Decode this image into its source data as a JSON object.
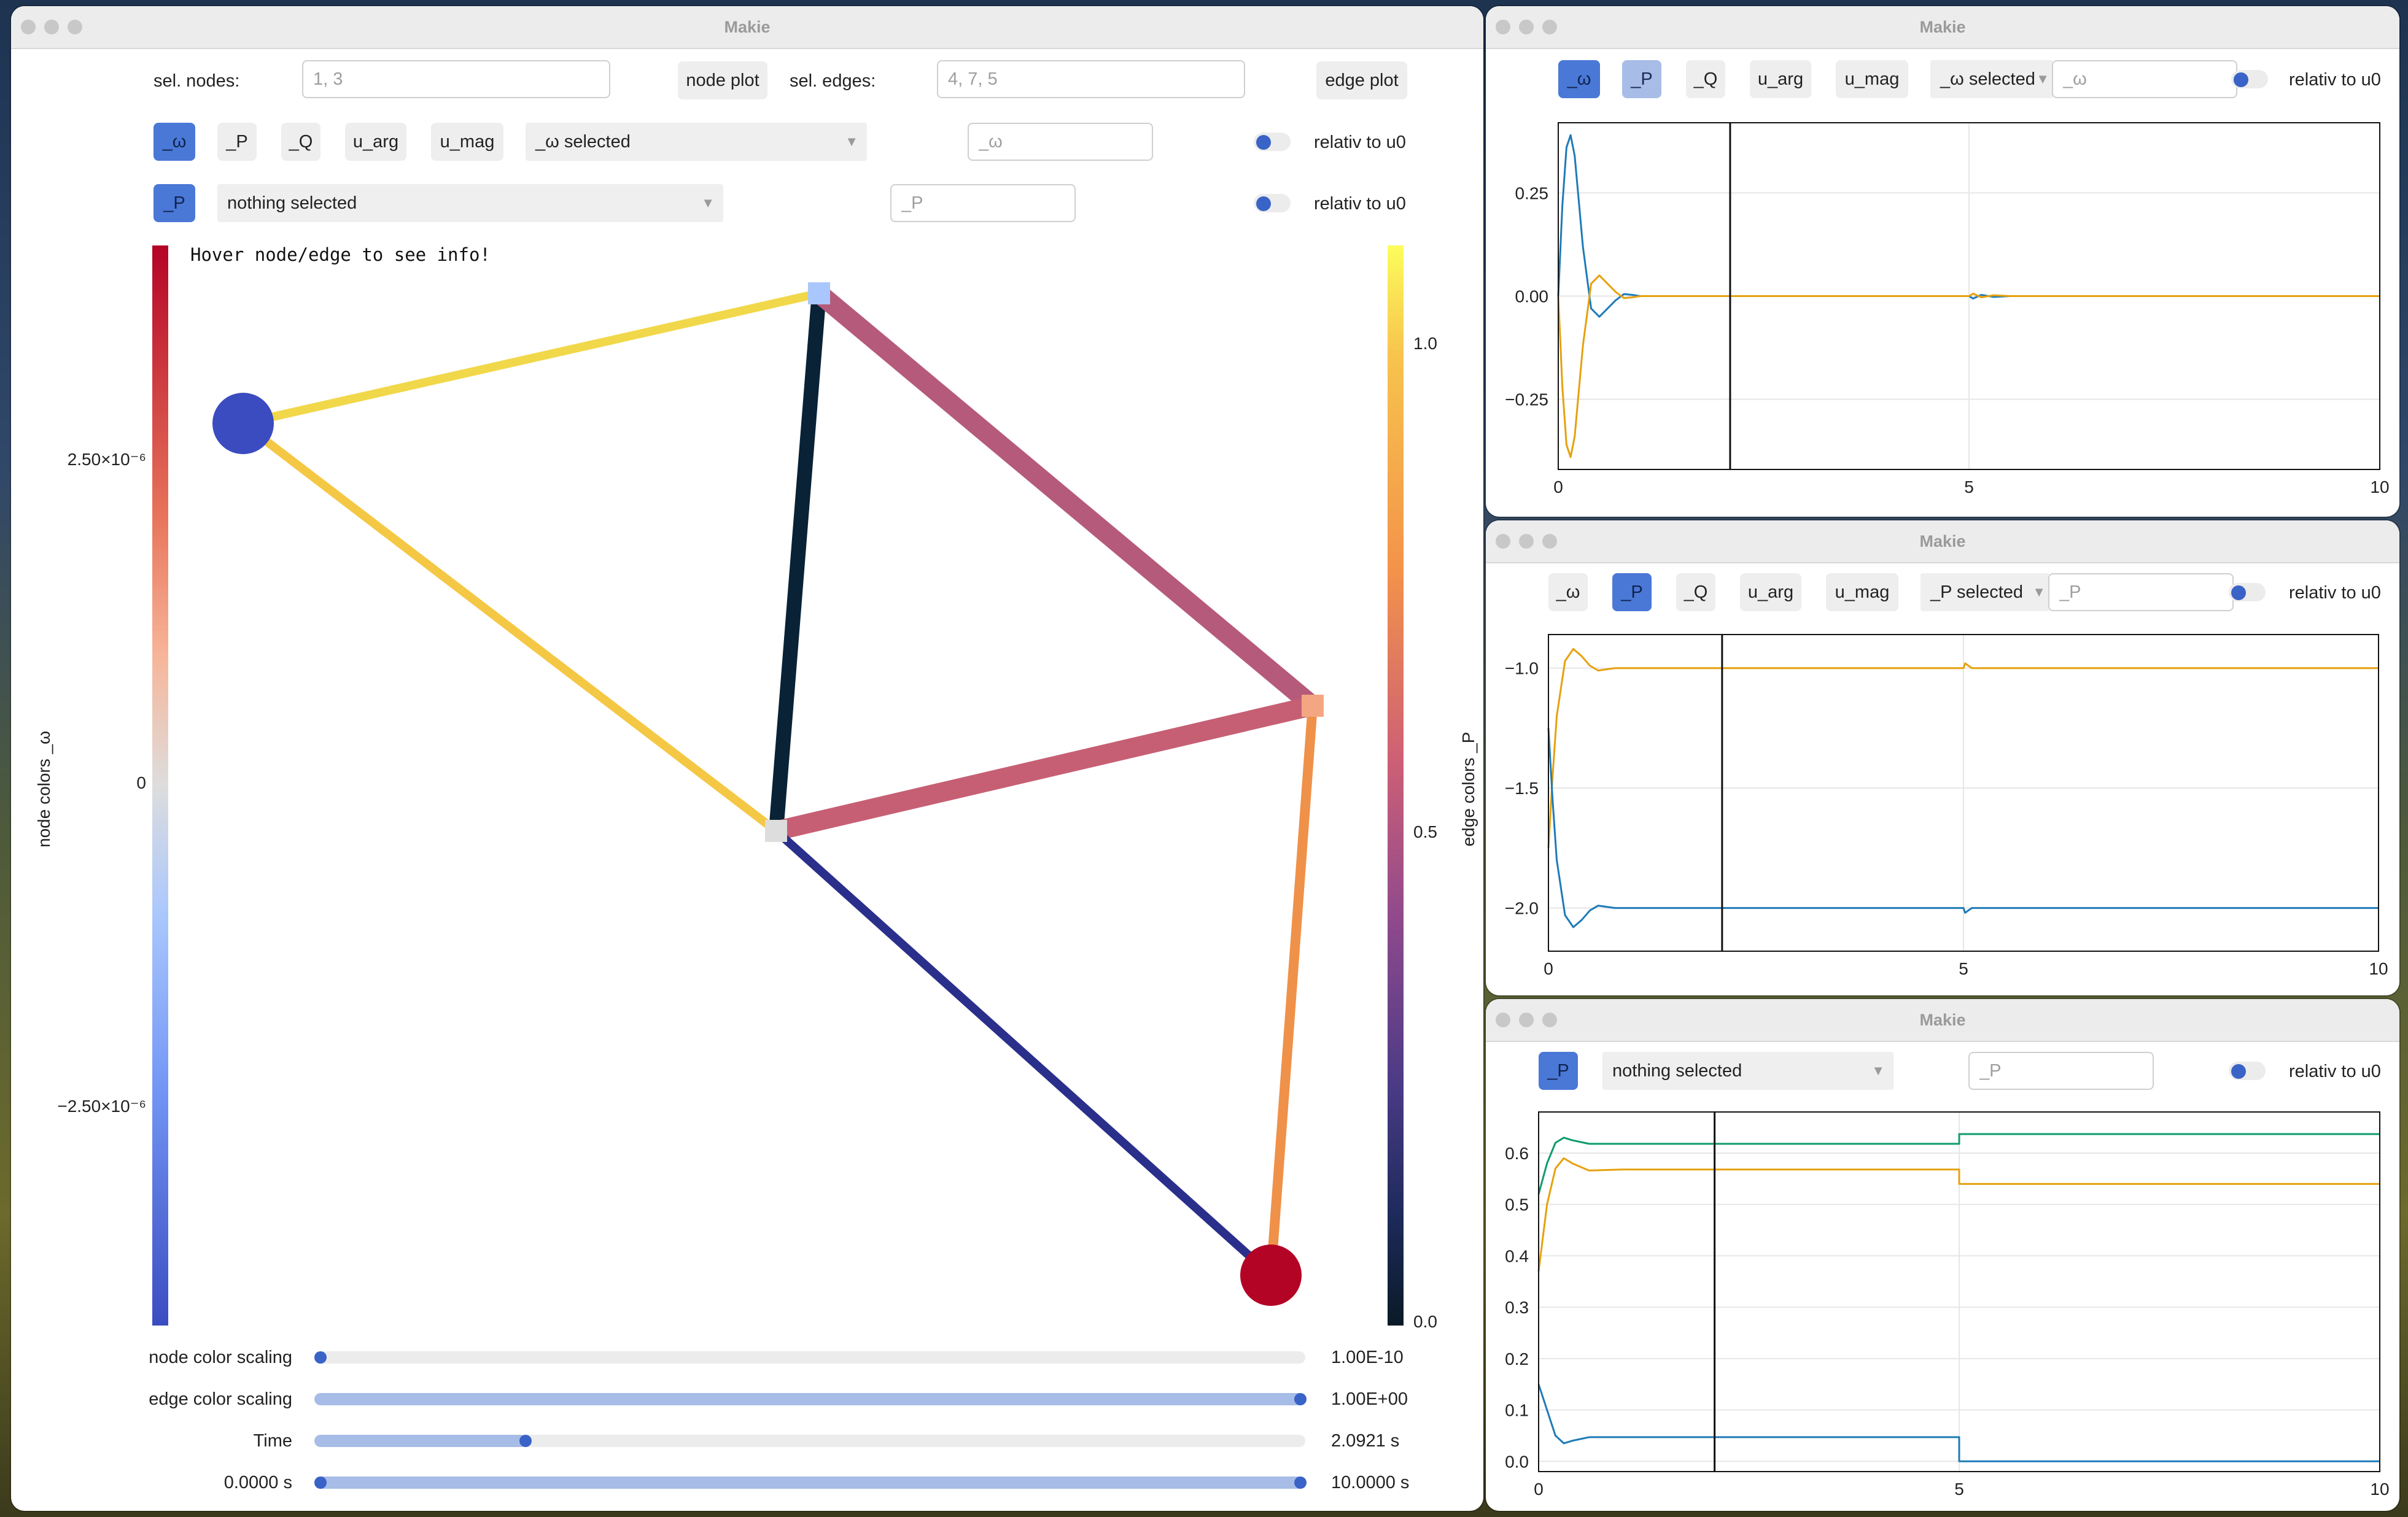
{
  "colors": {
    "accent": "#4a78d6",
    "accent_light": "#a8bce8",
    "edge_high": "#f0d84a",
    "edge_mid": "#c05a78",
    "edge_low": "#0a2236",
    "series_blue": "#1f7bb8",
    "series_orange": "#e6a10e",
    "series_green": "#0e9c6a"
  },
  "main_window": {
    "title": "Makie",
    "sel_nodes_label": "sel. nodes:",
    "sel_nodes_placeholder": "1, 3",
    "node_plot_button": "node plot",
    "sel_edges_label": "sel. edges:",
    "sel_edges_placeholder": "4, 7, 5",
    "edge_plot_button": "edge plot",
    "node_state_buttons": [
      "_ω",
      "_P",
      "_Q",
      "u_arg",
      "u_mag"
    ],
    "node_state_menu": "_ω selected",
    "node_state_textbox_placeholder": "_ω",
    "node_relativ_label": "relativ to u0",
    "edge_state_button": "_P",
    "edge_state_menu": "nothing selected",
    "edge_state_textbox_placeholder": "_P",
    "edge_relativ_label": "relativ to u0",
    "info_text": "Hover node/edge to see info!",
    "node_colorbar": {
      "label": "node colors _ω",
      "ticks": [
        {
          "value": 2.5e-06,
          "label": "2.50×10⁻⁶"
        },
        {
          "value": 0,
          "label": "0"
        },
        {
          "value": -2.5e-06,
          "label": "−2.50×10⁻⁶"
        }
      ]
    },
    "edge_colorbar": {
      "label": "edge colors _P",
      "ticks": [
        {
          "value": 1.0,
          "label": "1.0"
        },
        {
          "value": 0.5,
          "label": "0.5"
        },
        {
          "value": 0.0,
          "label": "0.0"
        }
      ]
    },
    "sliders": [
      {
        "label": "node color scaling",
        "value_text": "1.00E-10",
        "fraction": 0.0
      },
      {
        "label": "edge color scaling",
        "value_text": "1.00E+00",
        "fraction": 1.0
      },
      {
        "label": "Time",
        "value_text": "2.0921 s",
        "fraction": 0.209
      },
      {
        "label": "0.0000 s",
        "value_text": "10.0000 s",
        "fraction": 1.0,
        "range_start": 0.0
      }
    ]
  },
  "window_omega": {
    "title": "Makie",
    "buttons": [
      "_ω",
      "_P",
      "_Q",
      "u_arg",
      "u_mag"
    ],
    "menu": "_ω selected",
    "textbox_placeholder": "_ω",
    "relativ_label": "relativ to u0"
  },
  "window_p": {
    "title": "Makie",
    "buttons": [
      "_ω",
      "_P",
      "_Q",
      "u_arg",
      "u_mag"
    ],
    "menu": "_P selected",
    "textbox_placeholder": "_P",
    "relativ_label": "relativ to u0"
  },
  "window_edge": {
    "title": "Makie",
    "button": "_P",
    "menu": "nothing selected",
    "textbox_placeholder": "_P",
    "relativ_label": "relativ to u0"
  },
  "chart_data": [
    {
      "type": "line",
      "panel": "ω over time",
      "xlim": [
        0,
        10
      ],
      "ylim": [
        -0.42,
        0.42
      ],
      "xticks": [
        0,
        5,
        10
      ],
      "yticks": [
        0.25,
        0.0,
        -0.25
      ],
      "ytick_labels": [
        "0.25",
        "0.00",
        "−0.25"
      ],
      "grid": true,
      "time_marker": 2.0921,
      "series": [
        {
          "color": "series_blue",
          "x": [
            0,
            0.05,
            0.1,
            0.15,
            0.2,
            0.3,
            0.4,
            0.5,
            0.6,
            0.7,
            0.8,
            0.9,
            1.0,
            1.2,
            1.5,
            5.0,
            5.05,
            5.15,
            5.3,
            5.5,
            10
          ],
          "y": [
            0,
            0.22,
            0.36,
            0.39,
            0.34,
            0.12,
            -0.03,
            -0.05,
            -0.03,
            -0.01,
            0.005,
            0.003,
            0,
            0,
            0,
            0,
            -0.006,
            0.003,
            -0.002,
            0,
            0
          ]
        },
        {
          "color": "series_orange",
          "x": [
            0,
            0.05,
            0.1,
            0.15,
            0.2,
            0.3,
            0.4,
            0.5,
            0.6,
            0.7,
            0.8,
            0.9,
            1.0,
            1.2,
            1.5,
            5.0,
            5.05,
            5.15,
            5.3,
            5.5,
            10
          ],
          "y": [
            0,
            -0.22,
            -0.36,
            -0.39,
            -0.34,
            -0.12,
            0.03,
            0.05,
            0.03,
            0.01,
            -0.005,
            -0.003,
            0,
            0,
            0,
            0,
            0.006,
            -0.003,
            0.002,
            0,
            0
          ]
        }
      ]
    },
    {
      "type": "line",
      "panel": "P over time",
      "xlim": [
        0,
        10
      ],
      "ylim": [
        -2.18,
        -0.86
      ],
      "xticks": [
        0,
        5,
        10
      ],
      "yticks": [
        -1.0,
        -1.5,
        -2.0
      ],
      "ytick_labels": [
        "−1.0",
        "−1.5",
        "−2.0"
      ],
      "grid": true,
      "time_marker": 2.0921,
      "series": [
        {
          "color": "series_orange",
          "x": [
            0,
            0.05,
            0.1,
            0.2,
            0.3,
            0.4,
            0.5,
            0.6,
            0.8,
            1.0,
            5.0,
            5.02,
            5.1,
            5.3,
            10
          ],
          "y": [
            -1.75,
            -1.45,
            -1.2,
            -0.97,
            -0.92,
            -0.95,
            -0.99,
            -1.01,
            -1.0,
            -1.0,
            -1.0,
            -0.98,
            -1.0,
            -1.0,
            -1.0
          ]
        },
        {
          "color": "series_blue",
          "x": [
            0,
            0.05,
            0.1,
            0.2,
            0.3,
            0.4,
            0.5,
            0.6,
            0.8,
            1.0,
            5.0,
            5.02,
            5.1,
            5.3,
            10
          ],
          "y": [
            -1.25,
            -1.55,
            -1.8,
            -2.03,
            -2.08,
            -2.05,
            -2.01,
            -1.99,
            -2.0,
            -2.0,
            -2.0,
            -2.02,
            -2.0,
            -2.0,
            -2.0
          ]
        }
      ]
    },
    {
      "type": "line",
      "panel": "edge P over time",
      "xlim": [
        0,
        10
      ],
      "ylim": [
        -0.02,
        0.68
      ],
      "xticks": [
        0,
        5,
        10
      ],
      "yticks": [
        0.0,
        0.1,
        0.2,
        0.3,
        0.4,
        0.5,
        0.6
      ],
      "ytick_labels": [
        "0.0",
        "0.1",
        "0.2",
        "0.3",
        "0.4",
        "0.5",
        "0.6"
      ],
      "grid": true,
      "time_marker": 2.0921,
      "series": [
        {
          "color": "series_green",
          "x": [
            0,
            0.1,
            0.2,
            0.3,
            0.4,
            0.6,
            1.0,
            5.0,
            5.0001,
            10
          ],
          "y": [
            0.52,
            0.58,
            0.62,
            0.63,
            0.625,
            0.618,
            0.618,
            0.618,
            0.637,
            0.637
          ]
        },
        {
          "color": "series_orange",
          "x": [
            0,
            0.1,
            0.2,
            0.3,
            0.4,
            0.6,
            1.0,
            5.0,
            5.0001,
            10
          ],
          "y": [
            0.37,
            0.5,
            0.57,
            0.59,
            0.58,
            0.566,
            0.568,
            0.568,
            0.54,
            0.54
          ]
        },
        {
          "color": "series_blue",
          "x": [
            0,
            0.1,
            0.2,
            0.3,
            0.4,
            0.6,
            1.0,
            5.0,
            5.0001,
            10
          ],
          "y": [
            0.15,
            0.1,
            0.05,
            0.035,
            0.04,
            0.047,
            0.047,
            0.047,
            0.0,
            0.0
          ]
        }
      ]
    }
  ]
}
